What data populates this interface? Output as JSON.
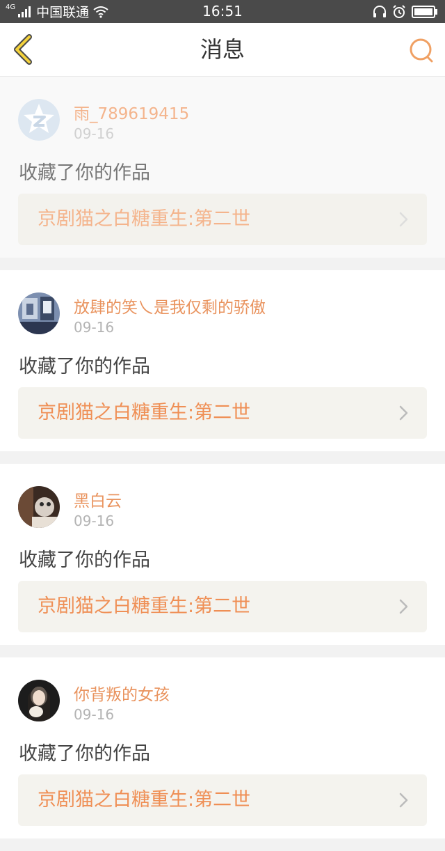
{
  "status_bar": {
    "network_tag": "4G",
    "carrier": "中国联通",
    "time": "16:51",
    "icons": [
      "signal-icon",
      "wifi-icon",
      "headphones-icon",
      "alarm-icon",
      "battery-icon"
    ]
  },
  "header": {
    "title": "消息",
    "back_icon": "chevron-left-icon",
    "search_icon": "search-icon",
    "accent_color": "#f0a063"
  },
  "notifications": [
    {
      "username": "雨_789619415",
      "date": "09-16",
      "action": "收藏了你的作品",
      "work_title": "京剧猫之白糖重生:第二世",
      "avatar": "default-avatar-icon"
    },
    {
      "username": "放肆的笑乀是我仅剩的骄傲",
      "date": "09-16",
      "action": "收藏了你的作品",
      "work_title": "京剧猫之白糖重生:第二世",
      "avatar": "user-photo-avatar"
    },
    {
      "username": "黑白云",
      "date": "09-16",
      "action": "收藏了你的作品",
      "work_title": "京剧猫之白糖重生:第二世",
      "avatar": "user-photo-avatar"
    },
    {
      "username": "你背叛的女孩",
      "date": "09-16",
      "action": "收藏了你的作品",
      "work_title": "京剧猫之白糖重生:第二世",
      "avatar": "user-photo-avatar"
    }
  ]
}
